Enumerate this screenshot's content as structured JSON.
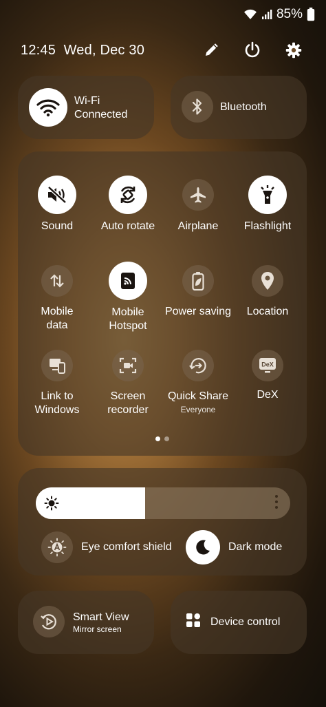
{
  "status": {
    "battery": "85%"
  },
  "header": {
    "time": "12:45",
    "date": "Wed, Dec 30"
  },
  "wifi": {
    "label": "Wi-Fi",
    "status": "Connected"
  },
  "bluetooth": {
    "label": "Bluetooth"
  },
  "tiles": [
    {
      "label": "Sound",
      "sub": "",
      "icon": "mute-icon",
      "active": true
    },
    {
      "label": "Auto rotate",
      "sub": "",
      "icon": "auto-rotate-icon",
      "active": true
    },
    {
      "label": "Airplane",
      "sub": "",
      "icon": "airplane-icon",
      "active": false
    },
    {
      "label": "Flashlight",
      "sub": "",
      "icon": "flashlight-icon",
      "active": true
    },
    {
      "label": "Mobile\ndata",
      "sub": "",
      "icon": "mobile-data-icon",
      "active": false
    },
    {
      "label": "Mobile\nHotspot",
      "sub": "",
      "icon": "hotspot-icon",
      "active": true
    },
    {
      "label": "Power saving",
      "sub": "",
      "icon": "battery-leaf-icon",
      "active": false
    },
    {
      "label": "Location",
      "sub": "",
      "icon": "location-pin-icon",
      "active": false
    },
    {
      "label": "Link to\nWindows",
      "sub": "",
      "icon": "link-to-windows-icon",
      "active": false
    },
    {
      "label": "Screen\nrecorder",
      "sub": "",
      "icon": "screen-recorder-icon",
      "active": false
    },
    {
      "label": "Quick Share",
      "sub": "Everyone",
      "icon": "quick-share-icon",
      "active": false
    },
    {
      "label": "DeX",
      "sub": "",
      "icon": "dex-icon",
      "active": false
    }
  ],
  "pages": {
    "count": 2,
    "current": 1
  },
  "brightness": {
    "level": 0.43
  },
  "eye_comfort": {
    "label": "Eye comfort shield"
  },
  "dark_mode": {
    "label": "Dark mode"
  },
  "smart_view": {
    "label": "Smart View",
    "sub": "Mirror screen"
  },
  "device_control": {
    "label": "Device control"
  },
  "icons": {
    "dex_text": "DeX"
  }
}
